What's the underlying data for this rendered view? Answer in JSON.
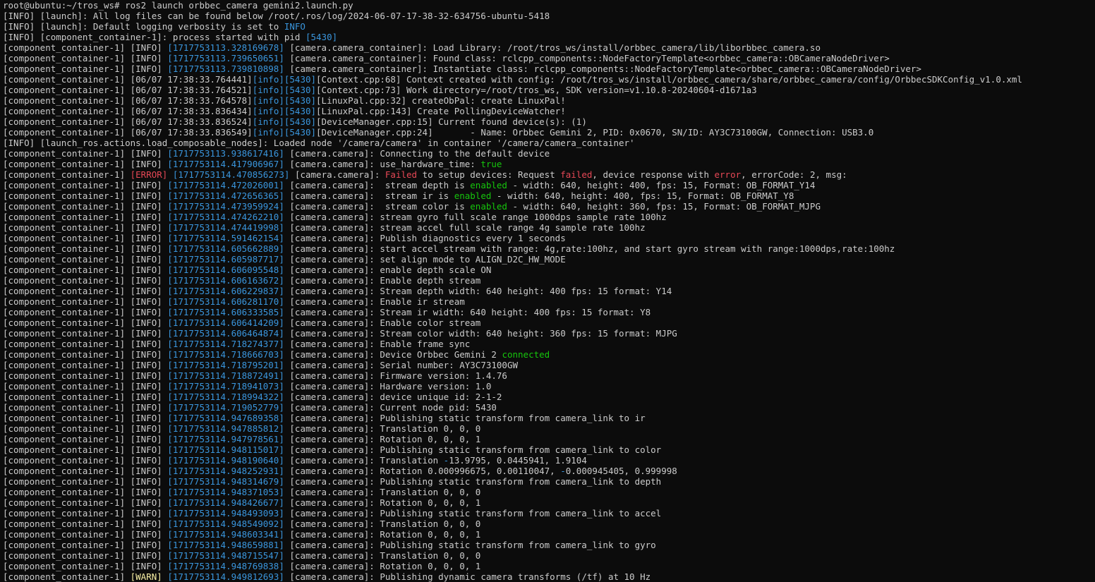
{
  "terminal": {
    "colors": {
      "background": "#0c0c0c",
      "foreground": "#cccccc",
      "blue": "#3a96dd",
      "green": "#16c60c",
      "red": "#e74856",
      "yellow": "#f9f1a5"
    },
    "lines": [
      [
        [
          "root@ubuntu:~/tros_ws# ros2 launch orbbec_camera gemini2.launch.py",
          "white"
        ]
      ],
      [
        [
          "[INFO] [launch]: All log files can be found below /root/.ros/log/2024-06-07-17-38-32-634756-ubuntu-5418",
          "white"
        ]
      ],
      [
        [
          "[INFO] [launch]: Default logging verbosity is set to ",
          "white"
        ],
        [
          "INFO",
          "blue"
        ]
      ],
      [
        [
          "[INFO] [component_container-1]: process started with pid ",
          "white"
        ],
        [
          "[5430]",
          "blue"
        ]
      ],
      [
        [
          "[component_container-1] [INFO] ",
          "white"
        ],
        [
          "[1717753113.328169678]",
          "blue"
        ],
        [
          " [camera.camera_container]: Load Library: /root/tros_ws/install/orbbec_camera/lib/liborbbec_camera.so",
          "white"
        ]
      ],
      [
        [
          "[component_container-1] [INFO] ",
          "white"
        ],
        [
          "[1717753113.739650651]",
          "blue"
        ],
        [
          " [camera.camera_container]: Found class: rclcpp_components::NodeFactoryTemplate<orbbec_camera::OBCameraNodeDriver>",
          "white"
        ]
      ],
      [
        [
          "[component_container-1] [INFO] ",
          "white"
        ],
        [
          "[1717753113.739810898]",
          "blue"
        ],
        [
          " [camera.camera_container]: Instantiate class: rclcpp_components::NodeFactoryTemplate<orbbec_camera::OBCameraNodeDriver>",
          "white"
        ]
      ],
      [
        [
          "[component_container-1] [06/07 17:38:33.764441]",
          "white"
        ],
        [
          "[info]",
          "blue"
        ],
        [
          "[5430]",
          "blue"
        ],
        [
          "[Context.cpp:68] Context created with config: /root/tros_ws/install/orbbec_camera/share/orbbec_camera/config/OrbbecSDKConfig_v1.0.xml",
          "white"
        ]
      ],
      [
        [
          "[component_container-1] [06/07 17:38:33.764521]",
          "white"
        ],
        [
          "[info]",
          "blue"
        ],
        [
          "[5430]",
          "blue"
        ],
        [
          "[Context.cpp:73] Work directory=/root/tros_ws, SDK version=v1.10.8-20240604-d1671a3",
          "white"
        ]
      ],
      [
        [
          "[component_container-1] [06/07 17:38:33.764578]",
          "white"
        ],
        [
          "[info]",
          "blue"
        ],
        [
          "[5430]",
          "blue"
        ],
        [
          "[LinuxPal.cpp:32] createObPal: create LinuxPal!",
          "white"
        ]
      ],
      [
        [
          "[component_container-1] [06/07 17:38:33.836434]",
          "white"
        ],
        [
          "[info]",
          "blue"
        ],
        [
          "[5430]",
          "blue"
        ],
        [
          "[LinuxPal.cpp:143] Create PollingDeviceWatcher!",
          "white"
        ]
      ],
      [
        [
          "[component_container-1] [06/07 17:38:33.836524]",
          "white"
        ],
        [
          "[info]",
          "blue"
        ],
        [
          "[5430]",
          "blue"
        ],
        [
          "[DeviceManager.cpp:15] Current found device(s): (1)",
          "white"
        ]
      ],
      [
        [
          "[component_container-1] [06/07 17:38:33.836549]",
          "white"
        ],
        [
          "[info]",
          "blue"
        ],
        [
          "[5430]",
          "blue"
        ],
        [
          "[DeviceManager.cpp:24]       - Name: Orbbec Gemini 2, PID: 0x0670, SN/ID: AY3C73100GW, Connection: USB3.0",
          "white"
        ]
      ],
      [
        [
          "[INFO] [launch_ros.actions.load_composable_nodes]: Loaded node '/camera/camera' in container '/camera/camera_container'",
          "white"
        ]
      ],
      [
        [
          "[component_container-1] [INFO] ",
          "white"
        ],
        [
          "[1717753113.938617416]",
          "blue"
        ],
        [
          " [camera.camera]: Connecting to the default device",
          "white"
        ]
      ],
      [
        [
          "[component_container-1] [INFO] ",
          "white"
        ],
        [
          "[1717753114.417906967]",
          "blue"
        ],
        [
          " [camera.camera]: use_hardware_time: ",
          "white"
        ],
        [
          "true",
          "green"
        ]
      ],
      [
        [
          "[component_container-1] ",
          "white"
        ],
        [
          "[ERROR]",
          "red"
        ],
        [
          " ",
          "white"
        ],
        [
          "[1717753114.470856273]",
          "blue"
        ],
        [
          " [camera.camera]: ",
          "white"
        ],
        [
          "Failed",
          "red"
        ],
        [
          " to setup devices: Request ",
          "white"
        ],
        [
          "failed",
          "red"
        ],
        [
          ", device response with ",
          "white"
        ],
        [
          "error",
          "red"
        ],
        [
          ", errorCode: 2, msg:",
          "white"
        ]
      ],
      [
        [
          "[component_container-1] [INFO] ",
          "white"
        ],
        [
          "[1717753114.472026001]",
          "blue"
        ],
        [
          " [camera.camera]:  stream depth is ",
          "white"
        ],
        [
          "enabled",
          "green"
        ],
        [
          " - width: 640, height: 400, fps: 15, Format: OB_FORMAT_Y14",
          "white"
        ]
      ],
      [
        [
          "[component_container-1] [INFO] ",
          "white"
        ],
        [
          "[1717753114.472656365]",
          "blue"
        ],
        [
          " [camera.camera]:  stream ir is ",
          "white"
        ],
        [
          "enabled",
          "green"
        ],
        [
          " - width: 640, height: 400, fps: 15, Format: OB_FORMAT_Y8",
          "white"
        ]
      ],
      [
        [
          "[component_container-1] [INFO] ",
          "white"
        ],
        [
          "[1717753114.473959924]",
          "blue"
        ],
        [
          " [camera.camera]:  stream color is ",
          "white"
        ],
        [
          "enabled",
          "green"
        ],
        [
          " - width: 640, height: 360, fps: 15, Format: OB_FORMAT_MJPG",
          "white"
        ]
      ],
      [
        [
          "[component_container-1] [INFO] ",
          "white"
        ],
        [
          "[1717753114.474262210]",
          "blue"
        ],
        [
          " [camera.camera]: stream gyro full scale range 1000dps sample rate 100hz",
          "white"
        ]
      ],
      [
        [
          "[component_container-1] [INFO] ",
          "white"
        ],
        [
          "[1717753114.474419998]",
          "blue"
        ],
        [
          " [camera.camera]: stream accel full scale range 4g sample rate 100hz",
          "white"
        ]
      ],
      [
        [
          "[component_container-1] [INFO] ",
          "white"
        ],
        [
          "[1717753114.591462154]",
          "blue"
        ],
        [
          " [camera.camera]: Publish diagnostics every 1 seconds",
          "white"
        ]
      ],
      [
        [
          "[component_container-1] [INFO] ",
          "white"
        ],
        [
          "[1717753114.605662889]",
          "blue"
        ],
        [
          " [camera.camera]: start accel stream with range: 4g,rate:100hz, and start gyro stream with range:1000dps,rate:100hz",
          "white"
        ]
      ],
      [
        [
          "[component_container-1] [INFO] ",
          "white"
        ],
        [
          "[1717753114.605987717]",
          "blue"
        ],
        [
          " [camera.camera]: set align mode to ALIGN_D2C_HW_MODE",
          "white"
        ]
      ],
      [
        [
          "[component_container-1] [INFO] ",
          "white"
        ],
        [
          "[1717753114.606095548]",
          "blue"
        ],
        [
          " [camera.camera]: enable depth scale ON",
          "white"
        ]
      ],
      [
        [
          "[component_container-1] [INFO] ",
          "white"
        ],
        [
          "[1717753114.606163672]",
          "blue"
        ],
        [
          " [camera.camera]: Enable depth stream",
          "white"
        ]
      ],
      [
        [
          "[component_container-1] [INFO] ",
          "white"
        ],
        [
          "[1717753114.606229837]",
          "blue"
        ],
        [
          " [camera.camera]: Stream depth width: 640 height: 400 fps: 15 format: Y14",
          "white"
        ]
      ],
      [
        [
          "[component_container-1] [INFO] ",
          "white"
        ],
        [
          "[1717753114.606281170]",
          "blue"
        ],
        [
          " [camera.camera]: Enable ir stream",
          "white"
        ]
      ],
      [
        [
          "[component_container-1] [INFO] ",
          "white"
        ],
        [
          "[1717753114.606333585]",
          "blue"
        ],
        [
          " [camera.camera]: Stream ir width: 640 height: 400 fps: 15 format: Y8",
          "white"
        ]
      ],
      [
        [
          "[component_container-1] [INFO] ",
          "white"
        ],
        [
          "[1717753114.606414209]",
          "blue"
        ],
        [
          " [camera.camera]: Enable color stream",
          "white"
        ]
      ],
      [
        [
          "[component_container-1] [INFO] ",
          "white"
        ],
        [
          "[1717753114.606464874]",
          "blue"
        ],
        [
          " [camera.camera]: Stream color width: 640 height: 360 fps: 15 format: MJPG",
          "white"
        ]
      ],
      [
        [
          "[component_container-1] [INFO] ",
          "white"
        ],
        [
          "[1717753114.718274377]",
          "blue"
        ],
        [
          " [camera.camera]: Enable frame sync",
          "white"
        ]
      ],
      [
        [
          "[component_container-1] [INFO] ",
          "white"
        ],
        [
          "[1717753114.718666703]",
          "blue"
        ],
        [
          " [camera.camera]: Device Orbbec Gemini 2 ",
          "white"
        ],
        [
          "connected",
          "green"
        ]
      ],
      [
        [
          "[component_container-1] [INFO] ",
          "white"
        ],
        [
          "[1717753114.718795201]",
          "blue"
        ],
        [
          " [camera.camera]: Serial number: AY3C73100GW",
          "white"
        ]
      ],
      [
        [
          "[component_container-1] [INFO] ",
          "white"
        ],
        [
          "[1717753114.718872491]",
          "blue"
        ],
        [
          " [camera.camera]: Firmware version: 1.4.76",
          "white"
        ]
      ],
      [
        [
          "[component_container-1] [INFO] ",
          "white"
        ],
        [
          "[1717753114.718941073]",
          "blue"
        ],
        [
          " [camera.camera]: Hardware version: 1.0",
          "white"
        ]
      ],
      [
        [
          "[component_container-1] [INFO] ",
          "white"
        ],
        [
          "[1717753114.718994322]",
          "blue"
        ],
        [
          " [camera.camera]: device unique id: 2-1-2",
          "white"
        ]
      ],
      [
        [
          "[component_container-1] [INFO] ",
          "white"
        ],
        [
          "[1717753114.719052779]",
          "blue"
        ],
        [
          " [camera.camera]: Current node pid: 5430",
          "white"
        ]
      ],
      [
        [
          "[component_container-1] [INFO] ",
          "white"
        ],
        [
          "[1717753114.947689358]",
          "blue"
        ],
        [
          " [camera.camera]: Publishing static transform from camera_link to ir",
          "white"
        ]
      ],
      [
        [
          "[component_container-1] [INFO] ",
          "white"
        ],
        [
          "[1717753114.947885812]",
          "blue"
        ],
        [
          " [camera.camera]: Translation 0, 0, 0",
          "white"
        ]
      ],
      [
        [
          "[component_container-1] [INFO] ",
          "white"
        ],
        [
          "[1717753114.947978561]",
          "blue"
        ],
        [
          " [camera.camera]: Rotation 0, 0, 0, 1",
          "white"
        ]
      ],
      [
        [
          "[component_container-1] [INFO] ",
          "white"
        ],
        [
          "[1717753114.948115017]",
          "blue"
        ],
        [
          " [camera.camera]: Publishing static transform from camera_link to color",
          "white"
        ]
      ],
      [
        [
          "[component_container-1] [INFO] ",
          "white"
        ],
        [
          "[1717753114.948190640]",
          "blue"
        ],
        [
          " [camera.camera]: Translation ",
          "white"
        ],
        [
          "-",
          "blue"
        ],
        [
          "13.9795, 0.0445941, 1.9104",
          "white"
        ]
      ],
      [
        [
          "[component_container-1] [INFO] ",
          "white"
        ],
        [
          "[1717753114.948252931]",
          "blue"
        ],
        [
          " [camera.camera]: Rotation 0.000996675, 0.00110047, ",
          "white"
        ],
        [
          "-",
          "blue"
        ],
        [
          "0.000945405, 0.999998",
          "white"
        ]
      ],
      [
        [
          "[component_container-1] [INFO] ",
          "white"
        ],
        [
          "[1717753114.948314679]",
          "blue"
        ],
        [
          " [camera.camera]: Publishing static transform from camera_link to depth",
          "white"
        ]
      ],
      [
        [
          "[component_container-1] [INFO] ",
          "white"
        ],
        [
          "[1717753114.948371053]",
          "blue"
        ],
        [
          " [camera.camera]: Translation 0, 0, 0",
          "white"
        ]
      ],
      [
        [
          "[component_container-1] [INFO] ",
          "white"
        ],
        [
          "[1717753114.948426677]",
          "blue"
        ],
        [
          " [camera.camera]: Rotation 0, 0, 0, 1",
          "white"
        ]
      ],
      [
        [
          "[component_container-1] [INFO] ",
          "white"
        ],
        [
          "[1717753114.948493093]",
          "blue"
        ],
        [
          " [camera.camera]: Publishing static transform from camera_link to accel",
          "white"
        ]
      ],
      [
        [
          "[component_container-1] [INFO] ",
          "white"
        ],
        [
          "[1717753114.948549092]",
          "blue"
        ],
        [
          " [camera.camera]: Translation 0, 0, 0",
          "white"
        ]
      ],
      [
        [
          "[component_container-1] [INFO] ",
          "white"
        ],
        [
          "[1717753114.948603341]",
          "blue"
        ],
        [
          " [camera.camera]: Rotation 0, 0, 0, 1",
          "white"
        ]
      ],
      [
        [
          "[component_container-1] [INFO] ",
          "white"
        ],
        [
          "[1717753114.948659881]",
          "blue"
        ],
        [
          " [camera.camera]: Publishing static transform from camera_link to gyro",
          "white"
        ]
      ],
      [
        [
          "[component_container-1] [INFO] ",
          "white"
        ],
        [
          "[1717753114.948715547]",
          "blue"
        ],
        [
          " [camera.camera]: Translation 0, 0, 0",
          "white"
        ]
      ],
      [
        [
          "[component_container-1] [INFO] ",
          "white"
        ],
        [
          "[1717753114.948769838]",
          "blue"
        ],
        [
          " [camera.camera]: Rotation 0, 0, 0, 1",
          "white"
        ]
      ],
      [
        [
          "[component_container-1] ",
          "white"
        ],
        [
          "[WARN]",
          "yellow"
        ],
        [
          " ",
          "white"
        ],
        [
          "[1717753114.949812693]",
          "blue"
        ],
        [
          " [camera.camera]: Publishing dynamic camera transforms (/tf) at 10 Hz",
          "white"
        ]
      ]
    ]
  }
}
